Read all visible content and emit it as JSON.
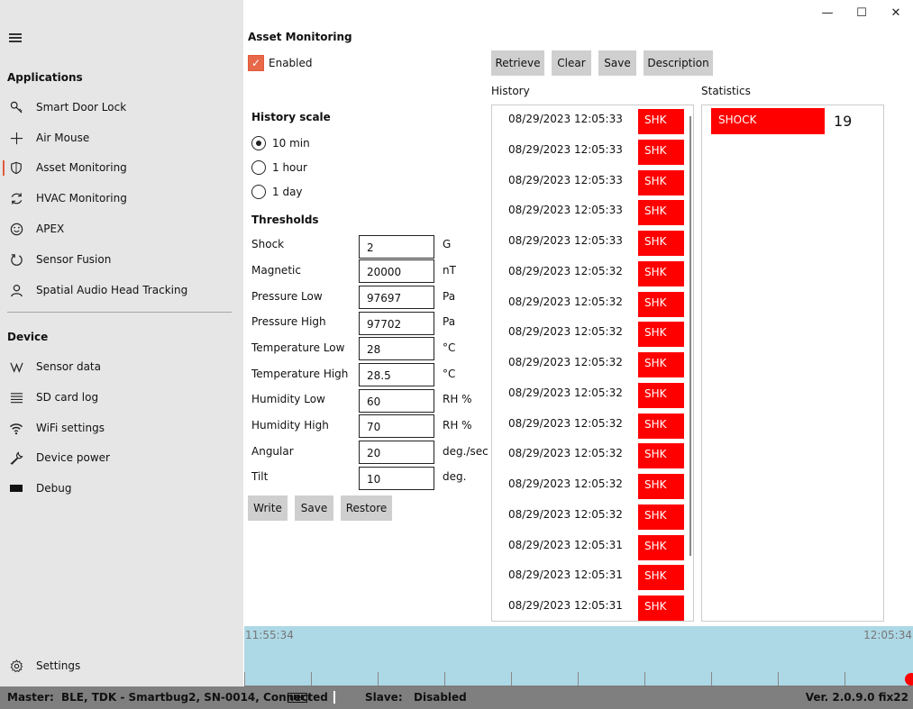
{
  "sidebar": {
    "applications_title": "Applications",
    "device_title": "Device",
    "apps": [
      {
        "label": "Smart Door Lock",
        "icon": "key-icon"
      },
      {
        "label": "Air Mouse",
        "icon": "plus-icon"
      },
      {
        "label": "Asset Monitoring",
        "icon": "shield-icon"
      },
      {
        "label": "HVAC Monitoring",
        "icon": "refresh-icon"
      },
      {
        "label": "APEX",
        "icon": "smiley-icon"
      },
      {
        "label": "Sensor Fusion",
        "icon": "circle-arrow-icon"
      },
      {
        "label": "Spatial Audio Head Tracking",
        "icon": "person-icon"
      }
    ],
    "devices": [
      {
        "label": "Sensor data",
        "icon": "wave-icon"
      },
      {
        "label": "SD card log",
        "icon": "list-icon"
      },
      {
        "label": "WiFi settings",
        "icon": "wifi-icon"
      },
      {
        "label": "Device power",
        "icon": "wrench-icon"
      },
      {
        "label": "Debug",
        "icon": "debug-icon"
      }
    ],
    "settings_label": "Settings"
  },
  "window_controls": {
    "minimize": "—",
    "maximize": "☐",
    "close": "✕"
  },
  "main": {
    "title": "Asset Monitoring",
    "enabled_label": "Enabled",
    "enabled_checked": true,
    "history_scale_title": "History scale",
    "scales": [
      {
        "label": "10 min",
        "checked": true
      },
      {
        "label": "1 hour",
        "checked": false
      },
      {
        "label": "1 day",
        "checked": false
      }
    ],
    "thresholds_title": "Thresholds",
    "thresholds": [
      {
        "label": "Shock",
        "value": "2",
        "unit": "G"
      },
      {
        "label": "Magnetic",
        "value": "20000",
        "unit": "nT"
      },
      {
        "label": "Pressure Low",
        "value": "97697",
        "unit": "Pa"
      },
      {
        "label": "Pressure High",
        "value": "97702",
        "unit": "Pa"
      },
      {
        "label": "Temperature Low",
        "value": "28",
        "unit": "°C"
      },
      {
        "label": "Temperature High",
        "value": "28.5",
        "unit": "°C"
      },
      {
        "label": "Humidity Low",
        "value": "60",
        "unit": "RH %"
      },
      {
        "label": "Humidity High",
        "value": "70",
        "unit": "RH %"
      },
      {
        "label": "Angular",
        "value": "20",
        "unit": "deg./sec"
      },
      {
        "label": "Tilt",
        "value": "10",
        "unit": "deg."
      }
    ],
    "threshold_buttons": {
      "write": "Write",
      "save": "Save",
      "restore": "Restore"
    },
    "top_buttons": {
      "retrieve": "Retrieve",
      "clear": "Clear",
      "save": "Save",
      "description": "Description"
    },
    "history_label": "History",
    "statistics_label": "Statistics",
    "history": [
      {
        "time": "08/29/2023 12:05:33",
        "tag": "SHK"
      },
      {
        "time": "08/29/2023 12:05:33",
        "tag": "SHK"
      },
      {
        "time": "08/29/2023 12:05:33",
        "tag": "SHK"
      },
      {
        "time": "08/29/2023 12:05:33",
        "tag": "SHK"
      },
      {
        "time": "08/29/2023 12:05:33",
        "tag": "SHK"
      },
      {
        "time": "08/29/2023 12:05:32",
        "tag": "SHK"
      },
      {
        "time": "08/29/2023 12:05:32",
        "tag": "SHK"
      },
      {
        "time": "08/29/2023 12:05:32",
        "tag": "SHK"
      },
      {
        "time": "08/29/2023 12:05:32",
        "tag": "SHK"
      },
      {
        "time": "08/29/2023 12:05:32",
        "tag": "SHK"
      },
      {
        "time": "08/29/2023 12:05:32",
        "tag": "SHK"
      },
      {
        "time": "08/29/2023 12:05:32",
        "tag": "SHK"
      },
      {
        "time": "08/29/2023 12:05:32",
        "tag": "SHK"
      },
      {
        "time": "08/29/2023 12:05:32",
        "tag": "SHK"
      },
      {
        "time": "08/29/2023 12:05:31",
        "tag": "SHK"
      },
      {
        "time": "08/29/2023 12:05:31",
        "tag": "SHK"
      },
      {
        "time": "08/29/2023 12:05:31",
        "tag": "SHK"
      }
    ],
    "statistics": [
      {
        "label": "SHOCK",
        "count": "19"
      }
    ],
    "timeline": {
      "start": "11:55:34",
      "end": "12:05:34",
      "accent": "#ff0000",
      "background": "#add8e6"
    }
  },
  "statusbar": {
    "master_label": "Master:",
    "master_value": "BLE, TDK - Smartbug2, SN-0014, Connected",
    "slave_label": "Slave:",
    "slave_value": "Disabled",
    "version": "Ver. 2.0.9.0 fix22"
  },
  "colors": {
    "accent": "#e05a3a",
    "alert": "#ff0000",
    "sidebar_bg": "#e6e6e6",
    "status_bg": "#7f7f7f"
  }
}
